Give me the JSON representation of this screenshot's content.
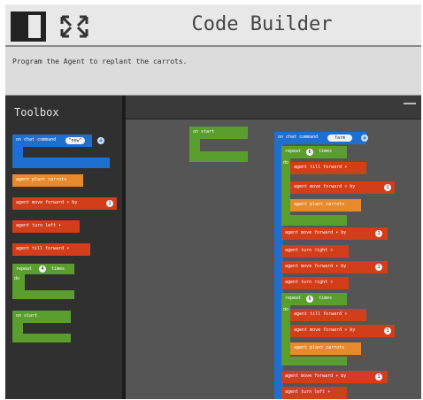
{
  "app": {
    "title": "Code Builder"
  },
  "instructions": {
    "text": "Program the Agent to replant the carrots."
  },
  "toolbox": {
    "title": "Toolbox",
    "blocks": {
      "on_chat": "on chat command",
      "on_chat_value": "\"new\"",
      "plant": "agent plant carrots",
      "move": "agent move  forward ▾  by",
      "move_value": "1",
      "turn_left": "agent turn  left ▾",
      "till": "agent till  forward ▾",
      "repeat": "repeat",
      "repeat_value": "4",
      "repeat_times": "times",
      "do": "do",
      "on_start": "on start"
    }
  },
  "workspace": {
    "on_start": "on start",
    "on_chat": "on chat command",
    "on_chat_value": "farm",
    "repeat": "repeat",
    "repeat_times": "times",
    "repeat1_value": "6",
    "repeat2_value": "6",
    "do": "do",
    "till": "agent till  forward ▾",
    "move": "agent move  forward ▾  by",
    "plant": "agent plant carrots",
    "turn_right": "agent turn  right ▾",
    "turn_left": "agent turn  left ▾",
    "move_value": "1"
  }
}
